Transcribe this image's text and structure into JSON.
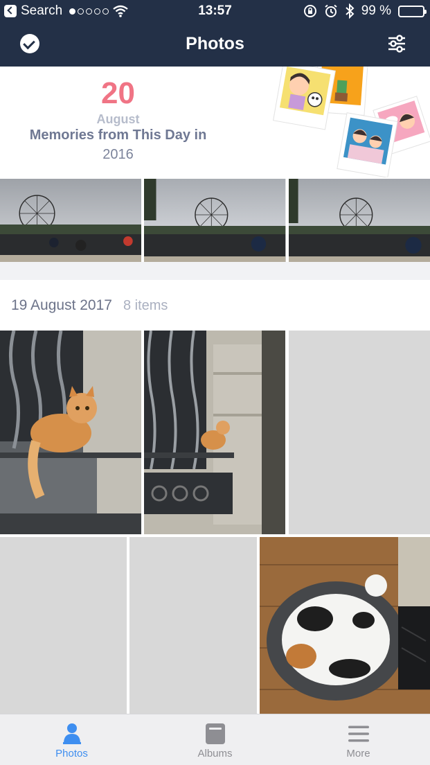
{
  "status_bar": {
    "back_label": "Search",
    "signal_dots": 5,
    "signal_strength": 1,
    "time": "13:57",
    "battery_text": "99 %",
    "battery_level": 0.99
  },
  "nav": {
    "title": "Photos",
    "select_icon": "checkmark-circle-icon",
    "filter_icon": "sliders-icon"
  },
  "memories": {
    "day": "20",
    "month": "August",
    "title": "Memories from This Day in",
    "year": "2016",
    "thumbnails": [
      "ferris-wheel-crowd",
      "ferris-wheel-crowd",
      "ferris-wheel-crowd"
    ]
  },
  "section": {
    "date": "19 August 2017",
    "count": "8 items"
  },
  "tabs": [
    {
      "label": "Photos",
      "icon": "person-icon",
      "active": true
    },
    {
      "label": "Albums",
      "icon": "album-icon",
      "active": false
    },
    {
      "label": "More",
      "icon": "menu-icon",
      "active": false
    }
  ],
  "colors": {
    "nav_bg": "#233047",
    "accent_pink": "#f07485",
    "tab_active": "#3e8ef0",
    "placeholder": "#d8d8d8"
  }
}
